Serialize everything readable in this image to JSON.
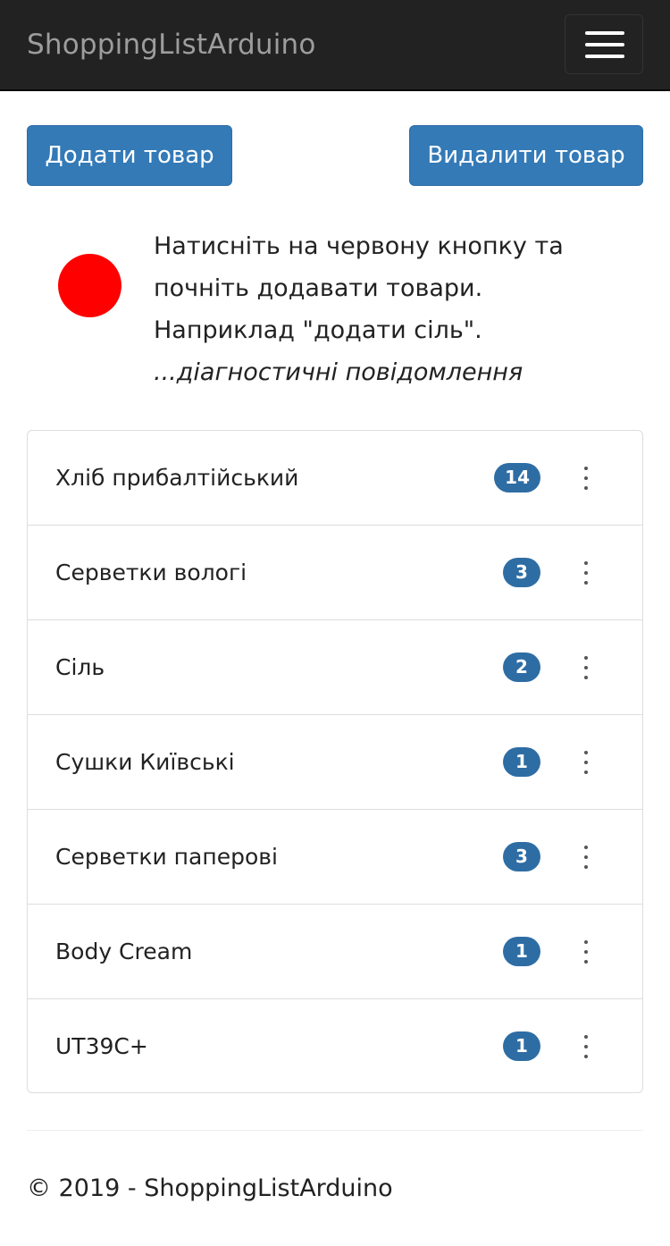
{
  "navbar": {
    "brand": "ShoppingListArduino",
    "menu_icon": "hamburger-icon"
  },
  "actions": {
    "add_label": "Додати товар",
    "remove_label": "Видалити товар"
  },
  "record": {
    "icon": "record-button-icon",
    "color": "#ff0000",
    "instruction_line1": "Натисніть на червону кнопку та",
    "instruction_line2": "почніть додавати товари.",
    "instruction_line3": "Наприклад \"додати сіль\".",
    "diagnostics": "...діагностичні повідомлення"
  },
  "items": [
    {
      "name": "Хліб прибалтійський",
      "count": "14"
    },
    {
      "name": "Серветки вологі",
      "count": "3"
    },
    {
      "name": "Сіль",
      "count": "2"
    },
    {
      "name": "Сушки Київські",
      "count": "1"
    },
    {
      "name": "Серветки паперові",
      "count": "3"
    },
    {
      "name": "Body Cream",
      "count": "1"
    },
    {
      "name": "UT39C+",
      "count": "1"
    }
  ],
  "footer": {
    "copyright": "© 2019 - ShoppingListArduino"
  },
  "colors": {
    "navbar_bg": "#222222",
    "primary": "#337ab7",
    "badge": "#2e6da4"
  }
}
